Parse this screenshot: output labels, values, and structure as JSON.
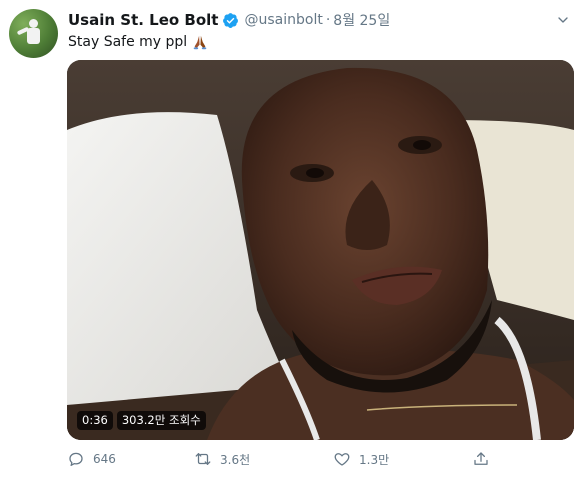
{
  "tweet": {
    "author_name": "Usain St. Leo Bolt",
    "handle": "@usainbolt",
    "separator": "·",
    "timestamp": "8월 25일",
    "text": "Stay Safe my ppl",
    "emoji_icon": "folded-hands-icon"
  },
  "media": {
    "type": "video",
    "duration": "0:36",
    "views": "303.2만 조회수"
  },
  "actions": {
    "reply_count": "646",
    "retweet_count": "3.6천",
    "like_count": "1.3만",
    "share_icon": "share-icon"
  },
  "colors": {
    "text_primary": "#14171a",
    "text_secondary": "#657786",
    "verified_blue": "#1da1f2"
  }
}
